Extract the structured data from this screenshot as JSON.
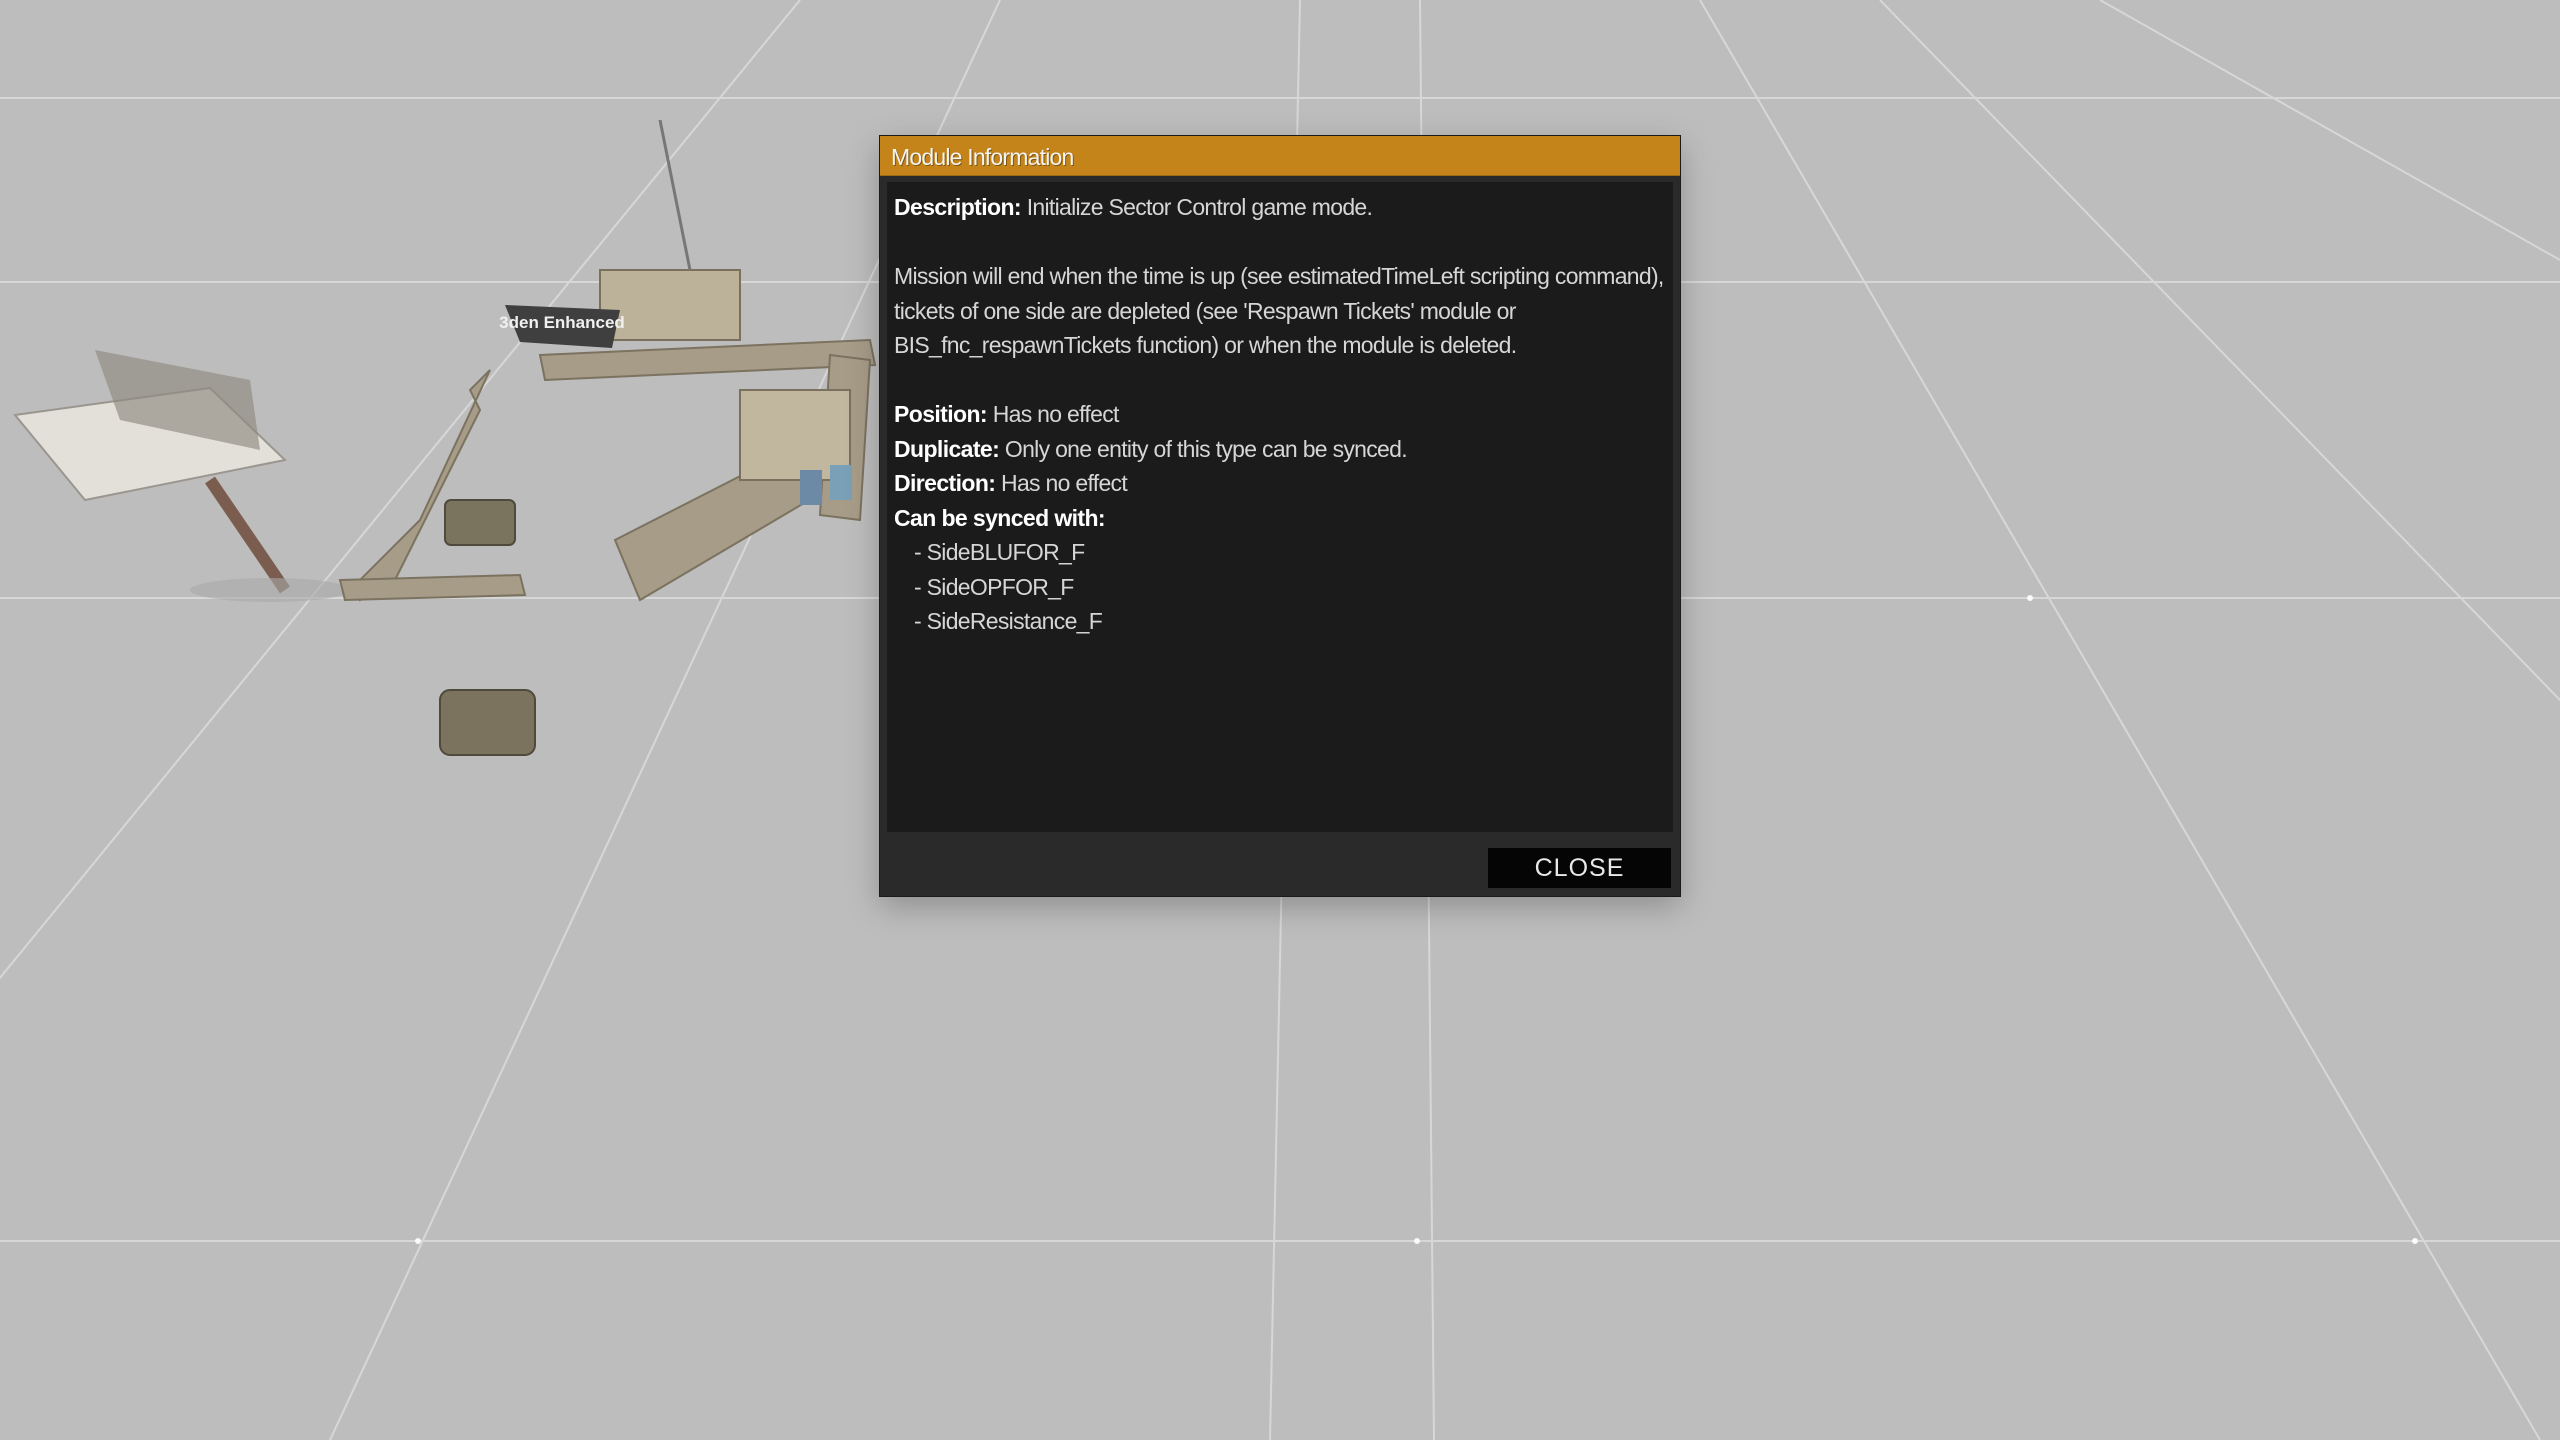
{
  "dialog": {
    "title": "Module Information",
    "description_label": "Description:",
    "description_text": "Initialize Sector Control game mode.",
    "mission_text": "Mission will end when the time is up (see estimatedTimeLeft scripting command), tickets of one side are depleted (see 'Respawn Tickets' module or BIS_fnc_respawnTickets function) or when the module is deleted.",
    "position_label": "Position:",
    "position_value": "Has no effect",
    "duplicate_label": "Duplicate:",
    "duplicate_value": "Only one entity of this type can be synced.",
    "direction_label": "Direction:",
    "direction_value": "Has no effect",
    "synced_label": "Can be synced with:",
    "synced_items": [
      "- SideBLUFOR_F",
      "- SideOPFOR_F",
      "- SideResistance_F"
    ],
    "close_label": "CLOSE"
  },
  "scene": {
    "sign_text": "3den Enhanced",
    "colors": {
      "ground": "#bdbdbd",
      "gridline": "#e6e6e6",
      "title_bar": "#c4841a",
      "panel": "#1b1b1b",
      "frame": "#2a2a2a"
    }
  }
}
